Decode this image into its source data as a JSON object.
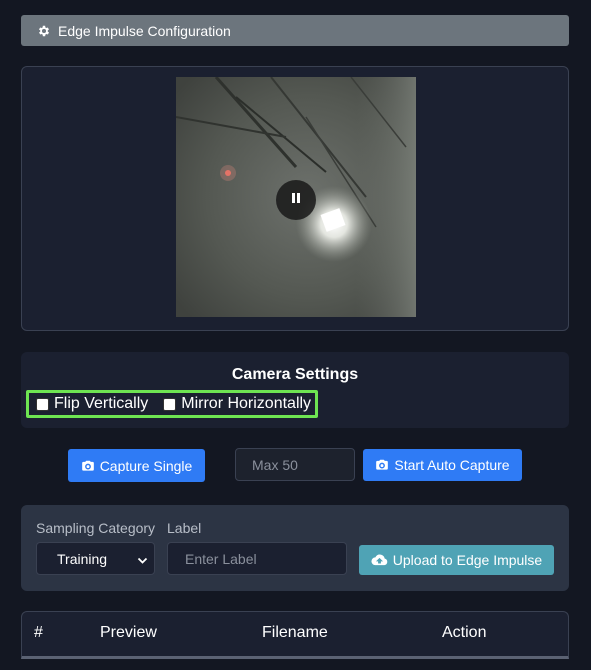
{
  "config": {
    "title": "Edge Impulse Configuration",
    "icon": "gear-icon"
  },
  "camera": {
    "pause_icon": "pause-icon"
  },
  "settings": {
    "title": "Camera Settings",
    "flip_label": "Flip Vertically",
    "mirror_label": "Mirror Horizontally",
    "highlight_color": "#6ee452"
  },
  "capture": {
    "single_label": "Capture Single",
    "max_placeholder": "Max 50",
    "auto_label": "Start Auto Capture",
    "button_color": "#2f7bf5"
  },
  "upload": {
    "category_label": "Sampling Category",
    "category_value": "Training",
    "label_label": "Label",
    "label_placeholder": "Enter Label",
    "upload_label": "Upload to Edge Impulse",
    "upload_color": "#4fa3b5"
  },
  "table": {
    "columns": [
      "#",
      "Preview",
      "Filename",
      "Action"
    ]
  }
}
